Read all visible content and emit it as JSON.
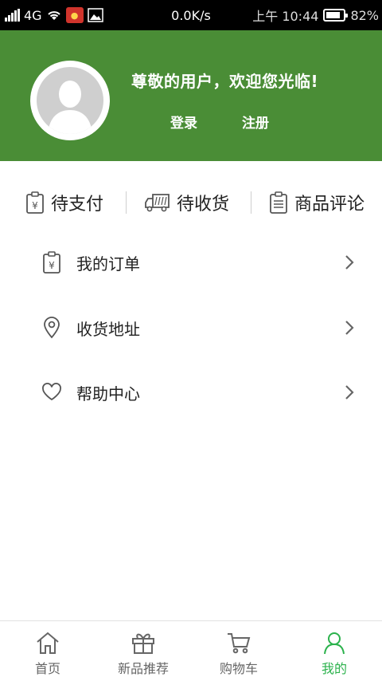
{
  "status_bar": {
    "network": "4G",
    "speed": "0.0K/s",
    "time": "上午 10:44",
    "battery_percent": 82,
    "battery_label": "82%"
  },
  "header": {
    "welcome": "尊敬的用户，欢迎您光临!",
    "login_label": "登录",
    "register_label": "注册",
    "background_color": "#4a8d36"
  },
  "quick_actions": [
    {
      "label": "待支付",
      "icon": "payment-clipboard-icon"
    },
    {
      "label": "待收货",
      "icon": "delivery-truck-icon"
    },
    {
      "label": "商品评论",
      "icon": "review-clipboard-icon"
    }
  ],
  "menu": [
    {
      "label": "我的订单",
      "icon": "order-clipboard-icon"
    },
    {
      "label": "收货地址",
      "icon": "location-pin-icon"
    },
    {
      "label": "帮助中心",
      "icon": "heart-icon"
    }
  ],
  "tabbar": {
    "active_color": "#2bb24c",
    "tabs": [
      {
        "label": "首页",
        "icon": "home-icon"
      },
      {
        "label": "新品推荐",
        "icon": "gift-icon"
      },
      {
        "label": "购物车",
        "icon": "cart-icon"
      },
      {
        "label": "我的",
        "icon": "user-icon",
        "active": true
      }
    ]
  }
}
